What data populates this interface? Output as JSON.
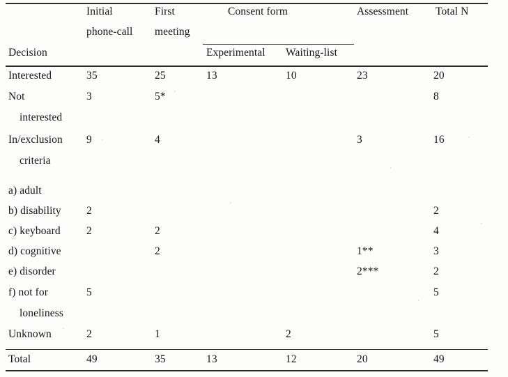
{
  "table": {
    "stub_header": "Decision",
    "header": {
      "col1_line1": "Initial",
      "col1_line2": "phone-call",
      "col2_line1": "First",
      "col2_line2": "meeting",
      "group_consent": "Consent form",
      "col3": "Experimental",
      "col4": "Waiting-list",
      "col5": "Assessment",
      "col6": "Total  N"
    },
    "rows": [
      {
        "label_line1": "Interested",
        "label_line2": "",
        "initial_phone_call": "35",
        "first_meeting": "25",
        "consent_experimental": "13",
        "consent_waiting_list": "10",
        "assessment": "23",
        "total_n": "20"
      },
      {
        "label_line1": "Not",
        "label_line2": "interested",
        "initial_phone_call": "3",
        "first_meeting": "5*",
        "consent_experimental": "",
        "consent_waiting_list": "",
        "assessment": "",
        "total_n": "8"
      },
      {
        "label_line1": "In/exclusion",
        "label_line2": "criteria",
        "initial_phone_call": "9",
        "first_meeting": "4",
        "consent_experimental": "",
        "consent_waiting_list": "",
        "assessment": "3",
        "total_n": "16"
      },
      {
        "label_line1": "a) adult",
        "label_line2": "",
        "initial_phone_call": "",
        "first_meeting": "",
        "consent_experimental": "",
        "consent_waiting_list": "",
        "assessment": "",
        "total_n": ""
      },
      {
        "label_line1": "b) disability",
        "label_line2": "",
        "initial_phone_call": "2",
        "first_meeting": "",
        "consent_experimental": "",
        "consent_waiting_list": "",
        "assessment": "",
        "total_n": "2"
      },
      {
        "label_line1": "c) keyboard",
        "label_line2": "",
        "initial_phone_call": "2",
        "first_meeting": "2",
        "consent_experimental": "",
        "consent_waiting_list": "",
        "assessment": "",
        "total_n": "4"
      },
      {
        "label_line1": "d) cognitive",
        "label_line2": "",
        "initial_phone_call": "",
        "first_meeting": "2",
        "consent_experimental": "",
        "consent_waiting_list": "",
        "assessment": "1**",
        "total_n": "3"
      },
      {
        "label_line1": "e) disorder",
        "label_line2": "",
        "initial_phone_call": "",
        "first_meeting": "",
        "consent_experimental": "",
        "consent_waiting_list": "",
        "assessment": "2***",
        "total_n": "2"
      },
      {
        "label_line1": "f) not for",
        "label_line2": "loneliness",
        "initial_phone_call": "5",
        "first_meeting": "",
        "consent_experimental": "",
        "consent_waiting_list": "",
        "assessment": "",
        "total_n": "5"
      },
      {
        "label_line1": "Unknown",
        "label_line2": "",
        "initial_phone_call": "2",
        "first_meeting": "1",
        "consent_experimental": "",
        "consent_waiting_list": "2",
        "assessment": "",
        "total_n": "5"
      }
    ],
    "total_row": {
      "label_line1": "Total",
      "label_line2": "",
      "initial_phone_call": "49",
      "first_meeting": "35",
      "consent_experimental": "13",
      "consent_waiting_list": "12",
      "assessment": "20",
      "total_n": "49"
    }
  }
}
